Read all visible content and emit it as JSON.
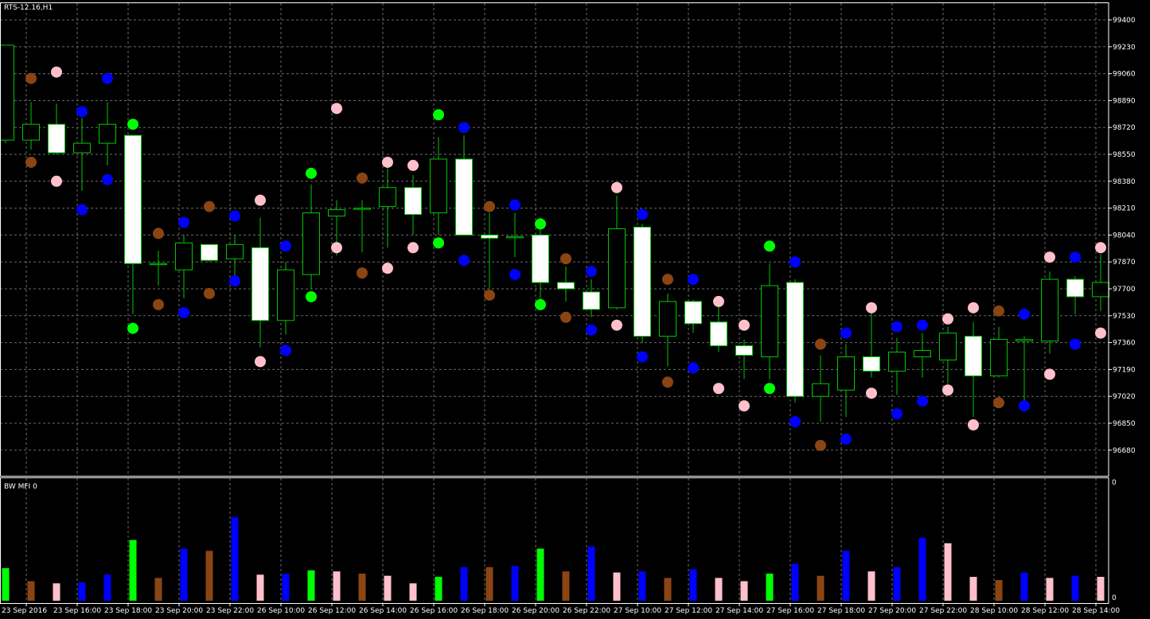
{
  "window": {
    "title": "RTS-12.16,H1"
  },
  "indicator": {
    "title": "BW MFI 0",
    "scale_top": "0",
    "scale_bottom": "0"
  },
  "colors": {
    "background": "#000000",
    "grid": "#6b6b6b",
    "frame": "#ffffff",
    "up_candle": "#000000",
    "down_candle": "#ffffff",
    "wick": "#00c800",
    "green": "#00ff00",
    "blue": "#0000ff",
    "brown": "#8b4513",
    "pink": "#ffc0cb"
  },
  "price_axis": {
    "ticks": [
      "99400",
      "99230",
      "99060",
      "98890",
      "98720",
      "98550",
      "98380",
      "98210",
      "98040",
      "97870",
      "97700",
      "97530",
      "97360",
      "97190",
      "97020",
      "96850",
      "96680"
    ]
  },
  "time_axis": {
    "labels": [
      "23 Sep 2016",
      "23 Sep 16:00",
      "23 Sep 18:00",
      "23 Sep 20:00",
      "23 Sep 22:00",
      "26 Sep 10:00",
      "26 Sep 12:00",
      "26 Sep 14:00",
      "26 Sep 16:00",
      "26 Sep 18:00",
      "26 Sep 20:00",
      "26 Sep 22:00",
      "27 Sep 10:00",
      "27 Sep 12:00",
      "27 Sep 14:00",
      "27 Sep 16:00",
      "27 Sep 18:00",
      "27 Sep 20:00",
      "27 Sep 22:00",
      "28 Sep 10:00",
      "28 Sep 12:00",
      "28 Sep 14:00"
    ]
  },
  "chart_data": {
    "type": "candlestick",
    "ylim": [
      96560,
      99460
    ],
    "candles": [
      {
        "o": 98640,
        "h": 99060,
        "l": 98620,
        "c": 99240
      },
      {
        "o": 98640,
        "h": 98880,
        "l": 98580,
        "c": 98740
      },
      {
        "o": 98740,
        "h": 98870,
        "l": 98550,
        "c": 98560
      },
      {
        "o": 98560,
        "h": 98780,
        "l": 98320,
        "c": 98620
      },
      {
        "o": 98620,
        "h": 98880,
        "l": 98480,
        "c": 98740
      },
      {
        "o": 98670,
        "h": 98670,
        "l": 97540,
        "c": 97860
      },
      {
        "o": 97860,
        "h": 97940,
        "l": 97720,
        "c": 97860
      },
      {
        "o": 97820,
        "h": 98040,
        "l": 97640,
        "c": 97990
      },
      {
        "o": 97980,
        "h": 97980,
        "l": 97870,
        "c": 97880
      },
      {
        "o": 97890,
        "h": 98040,
        "l": 97780,
        "c": 97980
      },
      {
        "o": 97960,
        "h": 98150,
        "l": 97330,
        "c": 97500
      },
      {
        "o": 97500,
        "h": 97870,
        "l": 97410,
        "c": 97820
      },
      {
        "o": 97790,
        "h": 98360,
        "l": 97700,
        "c": 98180
      },
      {
        "o": 98160,
        "h": 98260,
        "l": 97910,
        "c": 98200
      },
      {
        "o": 98210,
        "h": 98260,
        "l": 97930,
        "c": 98210
      },
      {
        "o": 98220,
        "h": 98460,
        "l": 97960,
        "c": 98340
      },
      {
        "o": 98340,
        "h": 98420,
        "l": 98040,
        "c": 98170
      },
      {
        "o": 98180,
        "h": 98660,
        "l": 98040,
        "c": 98520
      },
      {
        "o": 98520,
        "h": 98670,
        "l": 98050,
        "c": 98040
      },
      {
        "o": 98040,
        "h": 98180,
        "l": 97700,
        "c": 98020
      },
      {
        "o": 98030,
        "h": 98180,
        "l": 97900,
        "c": 98030
      },
      {
        "o": 98040,
        "h": 98150,
        "l": 97620,
        "c": 97740
      },
      {
        "o": 97740,
        "h": 97840,
        "l": 97620,
        "c": 97700
      },
      {
        "o": 97680,
        "h": 97760,
        "l": 97520,
        "c": 97570
      },
      {
        "o": 97580,
        "h": 98290,
        "l": 97570,
        "c": 98080
      },
      {
        "o": 98090,
        "h": 98110,
        "l": 97360,
        "c": 97400
      },
      {
        "o": 97400,
        "h": 97670,
        "l": 97210,
        "c": 97620
      },
      {
        "o": 97620,
        "h": 97630,
        "l": 97420,
        "c": 97480
      },
      {
        "o": 97490,
        "h": 97600,
        "l": 97300,
        "c": 97340
      },
      {
        "o": 97340,
        "h": 97380,
        "l": 97130,
        "c": 97280
      },
      {
        "o": 97270,
        "h": 97860,
        "l": 97130,
        "c": 97720
      },
      {
        "o": 97740,
        "h": 97760,
        "l": 96980,
        "c": 97020
      },
      {
        "o": 97020,
        "h": 97280,
        "l": 96860,
        "c": 97100
      },
      {
        "o": 97060,
        "h": 97350,
        "l": 96890,
        "c": 97270
      },
      {
        "o": 97270,
        "h": 97550,
        "l": 97140,
        "c": 97180
      },
      {
        "o": 97180,
        "h": 97390,
        "l": 97030,
        "c": 97300
      },
      {
        "o": 97270,
        "h": 97420,
        "l": 97140,
        "c": 97310
      },
      {
        "o": 97250,
        "h": 97460,
        "l": 97100,
        "c": 97420
      },
      {
        "o": 97400,
        "h": 97490,
        "l": 96890,
        "c": 97150
      },
      {
        "o": 97150,
        "h": 97460,
        "l": 97140,
        "c": 97380
      },
      {
        "o": 97370,
        "h": 97400,
        "l": 96990,
        "c": 97380
      },
      {
        "o": 97370,
        "h": 97810,
        "l": 97290,
        "c": 97760
      },
      {
        "o": 97760,
        "h": 97780,
        "l": 97540,
        "c": 97650
      },
      {
        "o": 97650,
        "h": 97920,
        "l": 97560,
        "c": 97740
      }
    ],
    "markers": [
      {
        "i": 1,
        "y": 99030,
        "c": "brown"
      },
      {
        "i": 1,
        "y": 98500,
        "c": "brown"
      },
      {
        "i": 2,
        "y": 99070,
        "c": "pink"
      },
      {
        "i": 2,
        "y": 98380,
        "c": "pink"
      },
      {
        "i": 3,
        "y": 98820,
        "c": "blue"
      },
      {
        "i": 3,
        "y": 98200,
        "c": "blue"
      },
      {
        "i": 4,
        "y": 99030,
        "c": "blue"
      },
      {
        "i": 4,
        "y": 98390,
        "c": "blue"
      },
      {
        "i": 5,
        "y": 98740,
        "c": "green"
      },
      {
        "i": 5,
        "y": 97450,
        "c": "green"
      },
      {
        "i": 6,
        "y": 98050,
        "c": "brown"
      },
      {
        "i": 6,
        "y": 97600,
        "c": "brown"
      },
      {
        "i": 7,
        "y": 98120,
        "c": "blue"
      },
      {
        "i": 7,
        "y": 97550,
        "c": "blue"
      },
      {
        "i": 8,
        "y": 98220,
        "c": "brown"
      },
      {
        "i": 8,
        "y": 97670,
        "c": "brown"
      },
      {
        "i": 9,
        "y": 98160,
        "c": "blue"
      },
      {
        "i": 9,
        "y": 97750,
        "c": "blue"
      },
      {
        "i": 10,
        "y": 98260,
        "c": "pink"
      },
      {
        "i": 10,
        "y": 97240,
        "c": "pink"
      },
      {
        "i": 11,
        "y": 97970,
        "c": "blue"
      },
      {
        "i": 11,
        "y": 97310,
        "c": "blue"
      },
      {
        "i": 12,
        "y": 98430,
        "c": "green"
      },
      {
        "i": 12,
        "y": 97650,
        "c": "green"
      },
      {
        "i": 13,
        "y": 98840,
        "c": "pink"
      },
      {
        "i": 13,
        "y": 97960,
        "c": "pink"
      },
      {
        "i": 14,
        "y": 98400,
        "c": "brown"
      },
      {
        "i": 14,
        "y": 97800,
        "c": "brown"
      },
      {
        "i": 15,
        "y": 98500,
        "c": "pink"
      },
      {
        "i": 15,
        "y": 97830,
        "c": "pink"
      },
      {
        "i": 16,
        "y": 98480,
        "c": "pink"
      },
      {
        "i": 16,
        "y": 97960,
        "c": "pink"
      },
      {
        "i": 17,
        "y": 98800,
        "c": "green"
      },
      {
        "i": 17,
        "y": 97990,
        "c": "green"
      },
      {
        "i": 18,
        "y": 98720,
        "c": "blue"
      },
      {
        "i": 18,
        "y": 97880,
        "c": "blue"
      },
      {
        "i": 19,
        "y": 98220,
        "c": "brown"
      },
      {
        "i": 19,
        "y": 97660,
        "c": "brown"
      },
      {
        "i": 20,
        "y": 98230,
        "c": "blue"
      },
      {
        "i": 20,
        "y": 97790,
        "c": "blue"
      },
      {
        "i": 21,
        "y": 98110,
        "c": "green"
      },
      {
        "i": 21,
        "y": 97600,
        "c": "green"
      },
      {
        "i": 22,
        "y": 97890,
        "c": "brown"
      },
      {
        "i": 22,
        "y": 97520,
        "c": "brown"
      },
      {
        "i": 23,
        "y": 97810,
        "c": "blue"
      },
      {
        "i": 23,
        "y": 97440,
        "c": "blue"
      },
      {
        "i": 24,
        "y": 98340,
        "c": "pink"
      },
      {
        "i": 24,
        "y": 97470,
        "c": "pink"
      },
      {
        "i": 25,
        "y": 98170,
        "c": "blue"
      },
      {
        "i": 25,
        "y": 97270,
        "c": "blue"
      },
      {
        "i": 26,
        "y": 97760,
        "c": "brown"
      },
      {
        "i": 26,
        "y": 97110,
        "c": "brown"
      },
      {
        "i": 27,
        "y": 97760,
        "c": "blue"
      },
      {
        "i": 27,
        "y": 97200,
        "c": "blue"
      },
      {
        "i": 28,
        "y": 97620,
        "c": "pink"
      },
      {
        "i": 28,
        "y": 97070,
        "c": "pink"
      },
      {
        "i": 29,
        "y": 97470,
        "c": "pink"
      },
      {
        "i": 29,
        "y": 96960,
        "c": "pink"
      },
      {
        "i": 30,
        "y": 97970,
        "c": "green"
      },
      {
        "i": 30,
        "y": 97070,
        "c": "green"
      },
      {
        "i": 31,
        "y": 97870,
        "c": "blue"
      },
      {
        "i": 31,
        "y": 96860,
        "c": "blue"
      },
      {
        "i": 32,
        "y": 97350,
        "c": "brown"
      },
      {
        "i": 32,
        "y": 96710,
        "c": "brown"
      },
      {
        "i": 33,
        "y": 97420,
        "c": "blue"
      },
      {
        "i": 33,
        "y": 96750,
        "c": "blue"
      },
      {
        "i": 34,
        "y": 97580,
        "c": "pink"
      },
      {
        "i": 34,
        "y": 97040,
        "c": "pink"
      },
      {
        "i": 35,
        "y": 97460,
        "c": "blue"
      },
      {
        "i": 35,
        "y": 96910,
        "c": "blue"
      },
      {
        "i": 36,
        "y": 97470,
        "c": "blue"
      },
      {
        "i": 36,
        "y": 96990,
        "c": "blue"
      },
      {
        "i": 37,
        "y": 97510,
        "c": "pink"
      },
      {
        "i": 37,
        "y": 97060,
        "c": "pink"
      },
      {
        "i": 38,
        "y": 97580,
        "c": "pink"
      },
      {
        "i": 38,
        "y": 96840,
        "c": "pink"
      },
      {
        "i": 39,
        "y": 97560,
        "c": "brown"
      },
      {
        "i": 39,
        "y": 96980,
        "c": "brown"
      },
      {
        "i": 40,
        "y": 97540,
        "c": "blue"
      },
      {
        "i": 40,
        "y": 96960,
        "c": "blue"
      },
      {
        "i": 41,
        "y": 97900,
        "c": "pink"
      },
      {
        "i": 41,
        "y": 97160,
        "c": "pink"
      },
      {
        "i": 42,
        "y": 97900,
        "c": "blue"
      },
      {
        "i": 42,
        "y": 97350,
        "c": "blue"
      },
      {
        "i": 43,
        "y": 97960,
        "c": "pink"
      },
      {
        "i": 43,
        "y": 97420,
        "c": "pink"
      }
    ],
    "mfi": {
      "ylim": [
        0,
        1.13
      ],
      "bars": [
        {
          "v": 0.3,
          "c": "green"
        },
        {
          "v": 0.18,
          "c": "brown"
        },
        {
          "v": 0.16,
          "c": "pink"
        },
        {
          "v": 0.17,
          "c": "blue"
        },
        {
          "v": 0.24,
          "c": "blue"
        },
        {
          "v": 0.56,
          "c": "green"
        },
        {
          "v": 0.21,
          "c": "brown"
        },
        {
          "v": 0.48,
          "c": "blue"
        },
        {
          "v": 0.46,
          "c": "brown"
        },
        {
          "v": 0.77,
          "c": "blue"
        },
        {
          "v": 0.24,
          "c": "pink"
        },
        {
          "v": 0.25,
          "c": "blue"
        },
        {
          "v": 0.28,
          "c": "green"
        },
        {
          "v": 0.27,
          "c": "pink"
        },
        {
          "v": 0.25,
          "c": "brown"
        },
        {
          "v": 0.23,
          "c": "pink"
        },
        {
          "v": 0.16,
          "c": "pink"
        },
        {
          "v": 0.22,
          "c": "green"
        },
        {
          "v": 0.31,
          "c": "blue"
        },
        {
          "v": 0.31,
          "c": "brown"
        },
        {
          "v": 0.32,
          "c": "blue"
        },
        {
          "v": 0.48,
          "c": "green"
        },
        {
          "v": 0.27,
          "c": "brown"
        },
        {
          "v": 0.5,
          "c": "blue"
        },
        {
          "v": 0.26,
          "c": "pink"
        },
        {
          "v": 0.27,
          "c": "blue"
        },
        {
          "v": 0.21,
          "c": "brown"
        },
        {
          "v": 0.29,
          "c": "blue"
        },
        {
          "v": 0.21,
          "c": "pink"
        },
        {
          "v": 0.18,
          "c": "pink"
        },
        {
          "v": 0.25,
          "c": "green"
        },
        {
          "v": 0.34,
          "c": "blue"
        },
        {
          "v": 0.23,
          "c": "brown"
        },
        {
          "v": 0.46,
          "c": "blue"
        },
        {
          "v": 0.27,
          "c": "pink"
        },
        {
          "v": 0.31,
          "c": "blue"
        },
        {
          "v": 0.58,
          "c": "blue"
        },
        {
          "v": 0.53,
          "c": "pink"
        },
        {
          "v": 0.22,
          "c": "pink"
        },
        {
          "v": 0.19,
          "c": "brown"
        },
        {
          "v": 0.26,
          "c": "blue"
        },
        {
          "v": 0.21,
          "c": "pink"
        },
        {
          "v": 0.23,
          "c": "blue"
        },
        {
          "v": 0.22,
          "c": "pink"
        }
      ]
    }
  }
}
